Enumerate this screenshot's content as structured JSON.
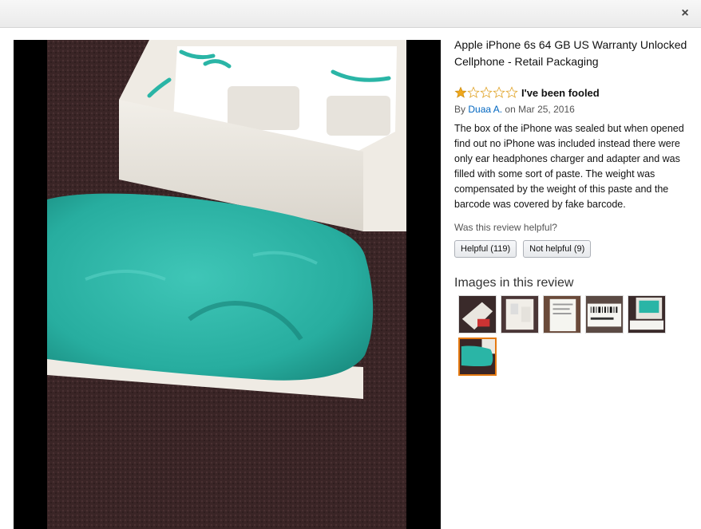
{
  "modal": {
    "close_label": "×"
  },
  "product": {
    "title": "Apple iPhone 6s 64 GB US Warranty Unlocked Cellphone - Retail Packaging"
  },
  "review": {
    "rating": 1,
    "rating_max": 5,
    "title": "I've been fooled",
    "by_prefix": "By",
    "author": "Duaa A.",
    "date_text": "on Mar 25, 2016",
    "body": "The box of the iPhone was sealed but when opened find out no iPhone was included instead there were only ear headphones charger and adapter and was filled with some sort of paste. The weight was compensated by the weight of this paste and the barcode was covered by fake barcode."
  },
  "helpful": {
    "question": "Was this review helpful?",
    "helpful_label": "Helpful (119)",
    "not_helpful_label": "Not helpful (9)"
  },
  "images": {
    "heading": "Images in this review",
    "thumbnails": [
      "thumb-1",
      "thumb-2",
      "thumb-3",
      "thumb-4",
      "thumb-5",
      "thumb-6"
    ],
    "selected_index": 6
  },
  "colors": {
    "star_fill": "#f0a81c",
    "link": "#0066c0",
    "selected_border": "#e47911",
    "paste": "#2ab5a6"
  }
}
